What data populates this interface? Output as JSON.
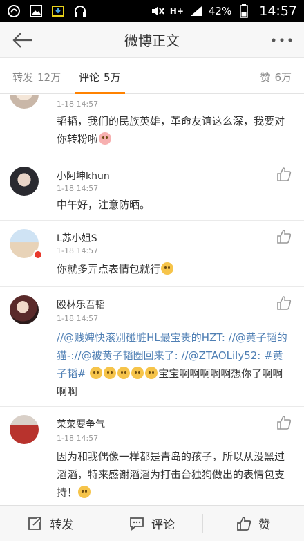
{
  "status_bar": {
    "network": "H+",
    "battery": "42%",
    "time": "14:57"
  },
  "header": {
    "title": "微博正文"
  },
  "tabs": {
    "repost": {
      "label": "转发",
      "count": "12万"
    },
    "comment": {
      "label": "评论",
      "count": "5万"
    },
    "like": {
      "label": "赞",
      "count": "6万"
    }
  },
  "comments": [
    {
      "time": "1-18 14:57",
      "text": "韬韬，我们的民族英雄，革命友谊这么深，我要对你转粉啦"
    },
    {
      "username": "小阿坤khun",
      "time": "1-18 14:57",
      "text": "中午好，注意防晒。"
    },
    {
      "username": "L苏小姐S",
      "time": "1-18 14:57",
      "text": "你就多弄点表情包就行"
    },
    {
      "username": "殴林乐吾韬",
      "time": "1-18 14:57",
      "segments": {
        "s1": "//",
        "s2": "@贱婢快滚别碰脏HL最宝贵的HZT",
        "s3": ": //",
        "s4": "@黄子韬的猫",
        "s5": "-://",
        "s6": "@被黄子韬圈回来了",
        "s7": ": //",
        "s8": "@ZTAOLily52",
        "s9": ": ",
        "s10": "#黄子韬#",
        "s11": "宝宝啊啊啊啊啊想你了啊啊啊啊"
      }
    },
    {
      "username": "菜菜要争气",
      "time": "1-18 14:57",
      "text": "因为和我偶像一样都是青岛的孩子，所以从没黑过滔滔，特来感谢滔滔为打击台独狗做出的表情包支持！"
    }
  ],
  "actions": {
    "repost": "转发",
    "comment": "评论",
    "like": "赞"
  }
}
